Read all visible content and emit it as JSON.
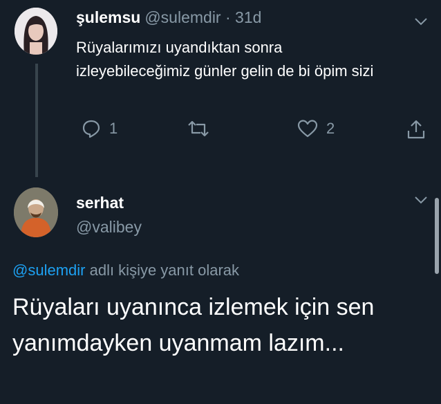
{
  "tweet1": {
    "display_name": "şulemsu",
    "handle": "@sulemdir",
    "separator": "·",
    "age": "31d",
    "text": "Rüyalarımızı uyandıktan sonra izleyebileceğimiz günler gelin de bi öpim sizi",
    "reply_count": "1",
    "retweet_count": "",
    "like_count": "2"
  },
  "tweet2": {
    "display_name": "serhat",
    "handle": "@valibey",
    "reply_to_handle": "@sulemdir",
    "reply_to_suffix": "adlı kişiye yanıt olarak",
    "text": "Rüyaları uyanınca izlemek için sen yanımdayken uyanmam lazım..."
  },
  "colors": {
    "background": "#151e28",
    "muted": "#8899a6",
    "link": "#1da1f2"
  }
}
